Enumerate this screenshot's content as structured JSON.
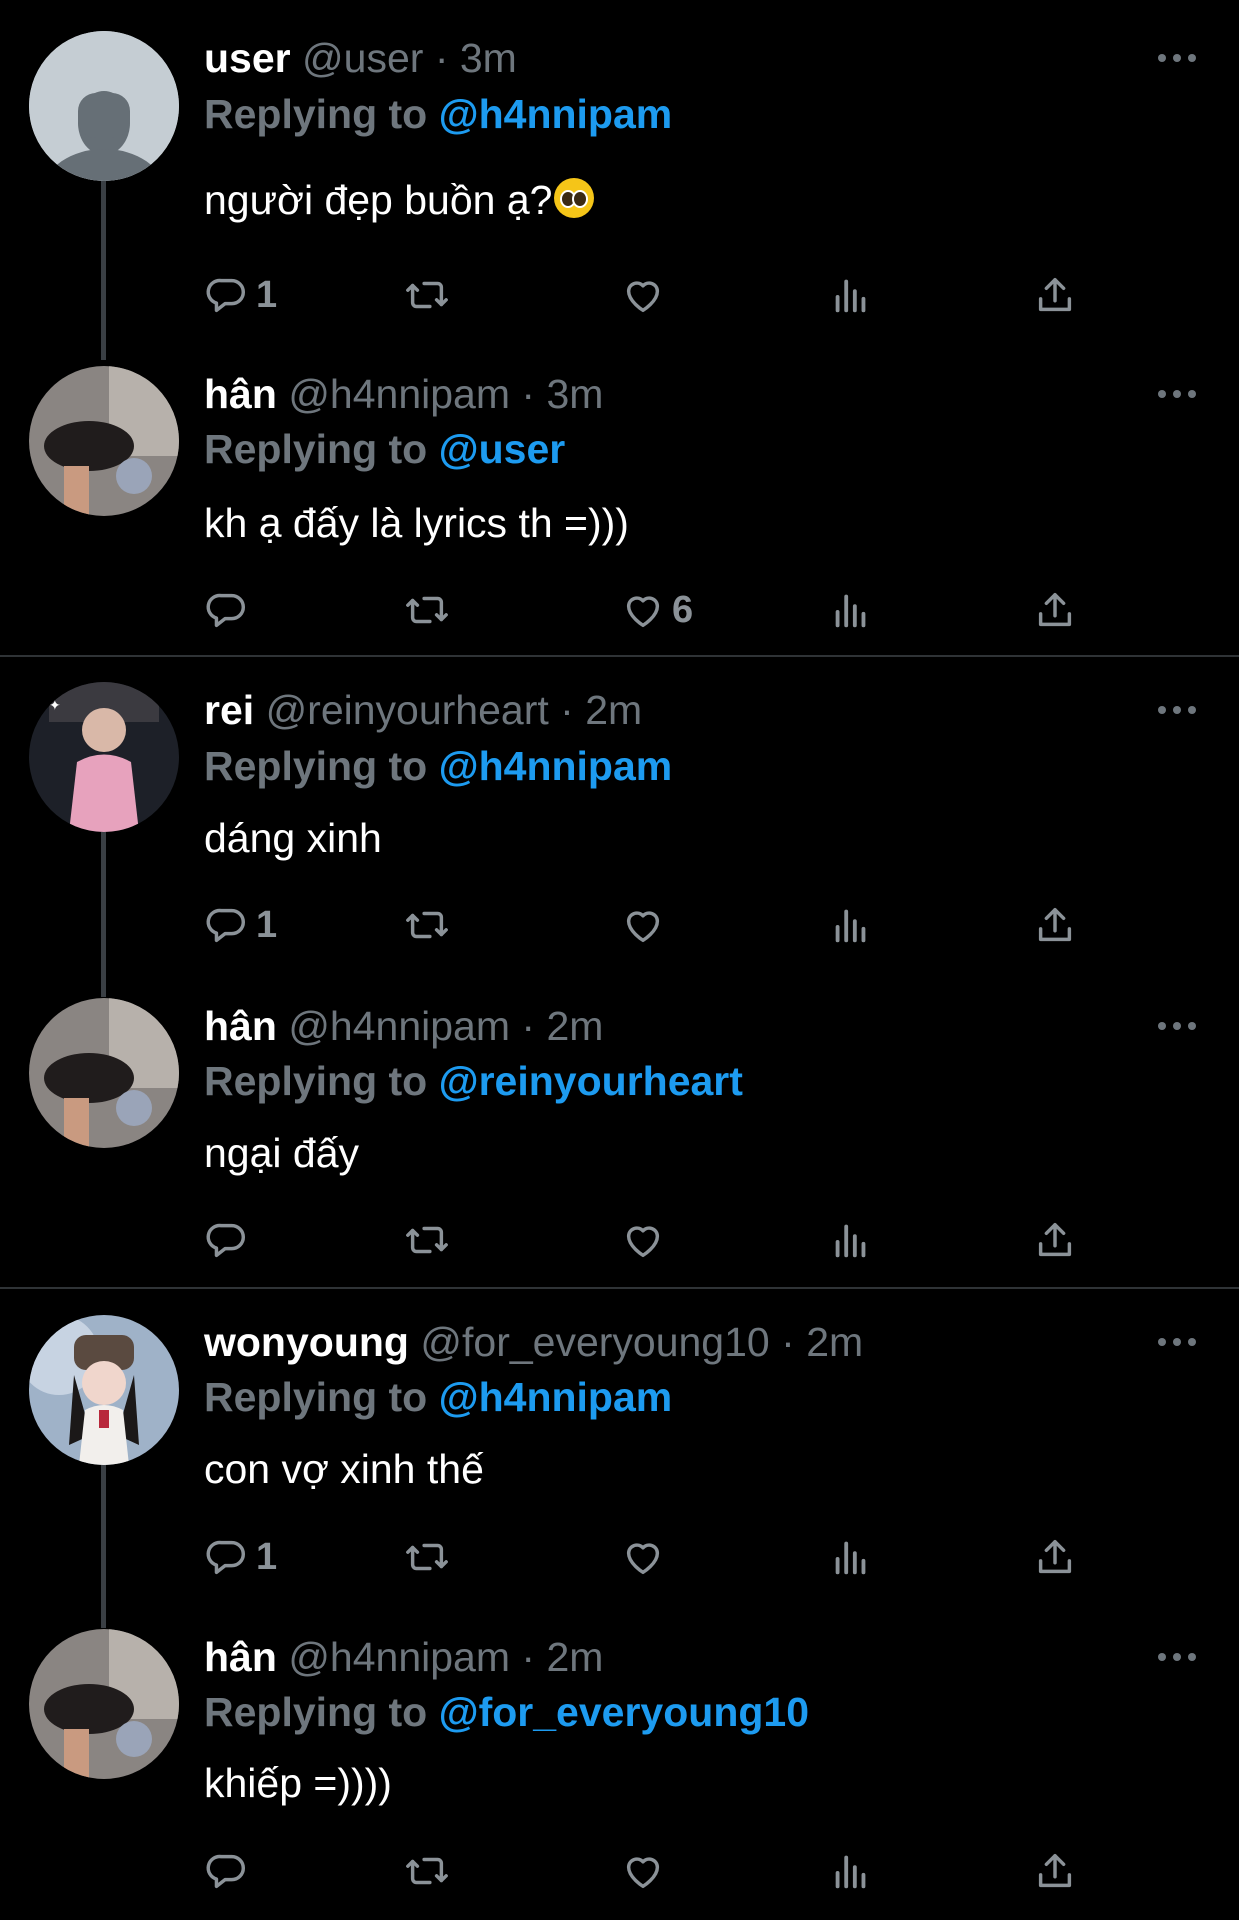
{
  "tweets": [
    {
      "name": "user",
      "handle": "@user",
      "time": "3m",
      "reply_prefix": "Replying to",
      "reply_to": "@h4nnipam",
      "text": "người đẹp buồn ạ?",
      "emoji_icon": "pleading-face-emoji",
      "replies": "1",
      "likes": ""
    },
    {
      "name": "hân",
      "handle": "@h4nnipam",
      "time": "3m",
      "reply_prefix": "Replying to",
      "reply_to": "@user",
      "text": "kh ạ đấy là lyrics th =)))",
      "replies": "",
      "likes": "6"
    },
    {
      "name": "rei",
      "handle": "@reinyourheart",
      "time": "2m",
      "reply_prefix": "Replying to",
      "reply_to": "@h4nnipam",
      "text": "dáng xinh",
      "replies": "1",
      "likes": ""
    },
    {
      "name": "hân",
      "handle": "@h4nnipam",
      "time": "2m",
      "reply_prefix": "Replying to",
      "reply_to": "@reinyourheart",
      "text": "ngại đấy",
      "replies": "",
      "likes": ""
    },
    {
      "name": "wonyoung",
      "handle": "@for_everyoung10",
      "time": "2m",
      "reply_prefix": "Replying to",
      "reply_to": "@h4nnipam",
      "text": "con vợ xinh thế",
      "replies": "1",
      "likes": ""
    },
    {
      "name": "hân",
      "handle": "@h4nnipam",
      "time": "2m",
      "reply_prefix": "Replying to",
      "reply_to": "@for_everyoung10",
      "text": "khiếp =))))",
      "replies": "",
      "likes": ""
    }
  ],
  "colors": {
    "background": "#000000",
    "accent": "#1d9bf0",
    "muted": "#6e767d",
    "divider": "#2f3336"
  }
}
